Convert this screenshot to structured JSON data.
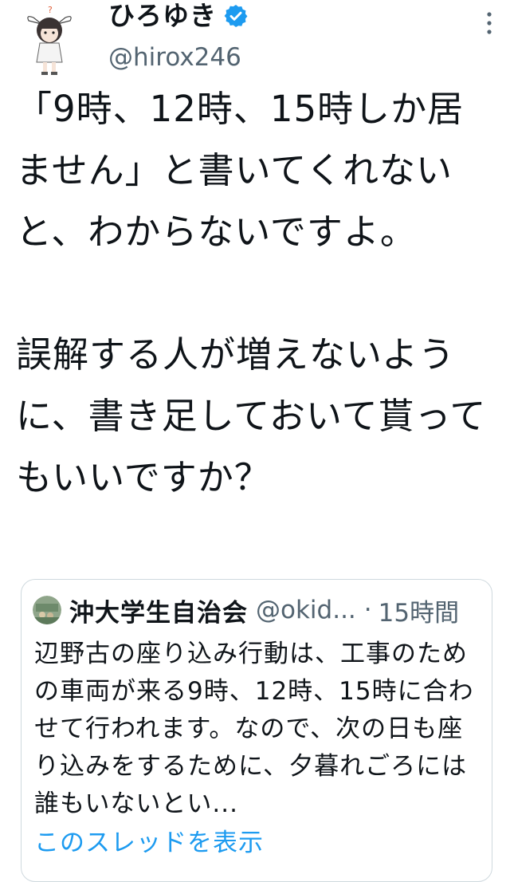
{
  "author": {
    "display_name": "ひろゆき",
    "handle": "@hirox246",
    "verified": true,
    "avatar_icon": "avatar-rabbit-girl-icon"
  },
  "tweet": {
    "text": "「9時、12時、15時しか居ません」と書いてくれないと、わからないですよ。\n\n誤解する人が増えないように、書き足しておいて貰ってもいいですか？"
  },
  "quoted_tweet": {
    "display_name": "沖大学生自治会",
    "handle": "@okid...",
    "separator": "·",
    "time": "15時間",
    "text": "辺野古の座り込み行動は、工事のための車両が来る9時、12時、15時に合わせて行われます。なので、次の日も座り込みをするために、夕暮れごろには誰もいないとい...",
    "show_thread_label": "このスレッドを表示"
  },
  "colors": {
    "text": "#0f1419",
    "secondary": "#536471",
    "accent": "#1d9bf0",
    "border": "#cfd9de"
  }
}
